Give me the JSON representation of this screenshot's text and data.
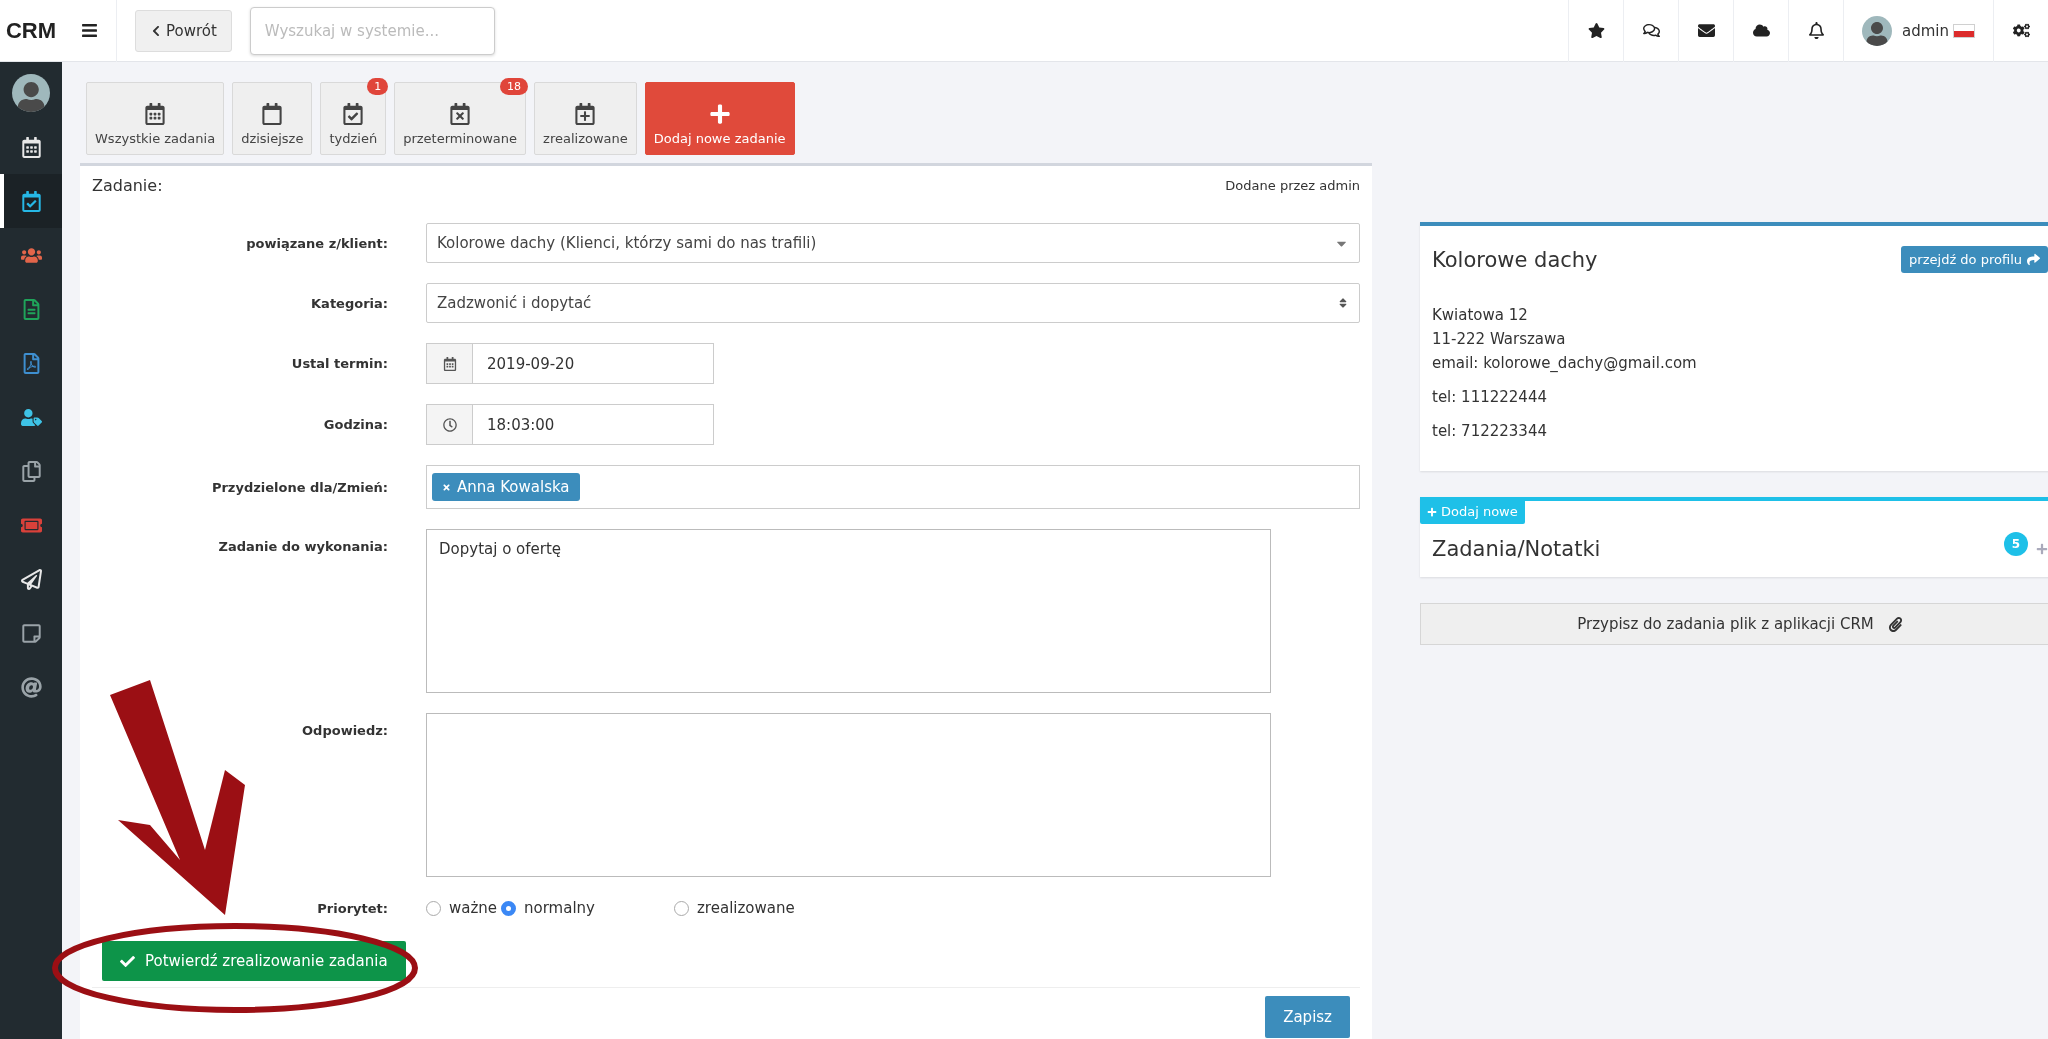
{
  "topbar": {
    "logo": "CRM",
    "back_button": "Powrót",
    "search": {
      "placeholder": "Wyszukaj w systemie..."
    },
    "user": "admin"
  },
  "sidebar": {
    "items": [
      {
        "selected": false,
        "color": "#e8e8e8"
      },
      {
        "selected": true,
        "color": "#26b8e6"
      },
      {
        "selected": false,
        "color": "#e2654a"
      },
      {
        "selected": false,
        "color": "#1fa45a"
      },
      {
        "selected": false,
        "color": "#3e8fd0"
      },
      {
        "selected": false,
        "color": "#3ec3e6"
      },
      {
        "selected": false,
        "color": "#9aa3a8"
      },
      {
        "selected": false,
        "color": "#d9413a"
      },
      {
        "selected": false,
        "color": "#e8e8e8"
      },
      {
        "selected": false,
        "color": "#9aa3a8"
      },
      {
        "selected": false,
        "color": "#9aa3a8"
      }
    ]
  },
  "task_filters": [
    {
      "label": "Wszystkie zadania"
    },
    {
      "label": "dzisiejsze"
    },
    {
      "label": "tydzień",
      "badge": "1"
    },
    {
      "label": "przeterminowane",
      "badge": "18"
    },
    {
      "label": "zrealizowane"
    }
  ],
  "add_task_button": "Dodaj nowe zadanie",
  "form": {
    "title": "Zadanie:",
    "added_by": "Dodane przez admin",
    "client": {
      "label": "powiązane z/klient:",
      "value": "Kolorowe dachy (Klienci, którzy sami do nas trafili)"
    },
    "category": {
      "label": "Kategoria:",
      "value": "Zadzwonić i dopytać"
    },
    "date": {
      "label": "Ustal termin:",
      "value": "2019-09-20"
    },
    "time": {
      "label": "Godzina:",
      "value": "18:03:00"
    },
    "assigned": {
      "label": "Przydzielone dla/Zmień:",
      "tags": [
        "Anna Kowalska"
      ]
    },
    "task": {
      "label": "Zadanie do wykonania:",
      "value": "Dopytaj o ofertę"
    },
    "answer": {
      "label": "Odpowiedz:"
    },
    "priority": {
      "label": "Priorytet:",
      "options": [
        {
          "label": "ważne",
          "selected": false
        },
        {
          "label": "normalny",
          "selected": true
        },
        {
          "label": "zrealizowane",
          "selected": false
        }
      ]
    },
    "confirm_button": "Potwierdź zrealizowanie zadania",
    "save_button": "Zapisz"
  },
  "client_card": {
    "name": "Kolorowe dachy",
    "profile_button": "przejdź do profilu",
    "address": [
      "Kwiatowa 12",
      "11-222 Warszawa",
      "email: kolorowe_dachy@gmail.com"
    ],
    "phones": [
      "tel: 111222444",
      "tel: 712223344"
    ]
  },
  "notes_card": {
    "add_button": "Dodaj nowe",
    "title": "Zadania/Notatki",
    "count": "5"
  },
  "attach_button": "Przypisz do zadania plik z aplikacji CRM"
}
